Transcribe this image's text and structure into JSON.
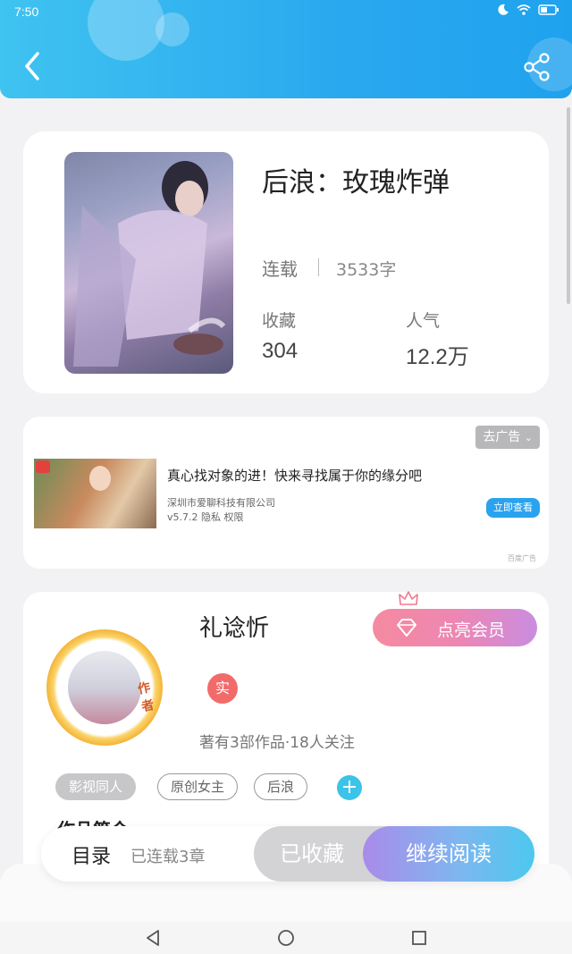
{
  "status": {
    "time": "7:50"
  },
  "book": {
    "title": "后浪：玫瑰炸弹",
    "status": "连载",
    "word_count": "3533字",
    "favorites_label": "收藏",
    "favorites_value": "304",
    "popularity_label": "人气",
    "popularity_value": "12.2万"
  },
  "ad": {
    "remove_label": "去广告",
    "title": "真心找对象的进！快来寻找属于你的缘分吧",
    "company": "深圳市爱聊科技有限公司",
    "meta": "v5.7.2 隐私 权限",
    "cta": "立即查看",
    "source": "百度广告"
  },
  "author": {
    "name": "礼谂忻",
    "avatar_tag": "作者",
    "vip_label": "点亮会员",
    "real_badge": "实",
    "stats": "著有3部作品·18人关注",
    "tags": [
      "影视同人",
      "原创女主",
      "后浪"
    ],
    "add_tag": "+",
    "intro_heading": "作品简介"
  },
  "actions": {
    "toc_label": "目录",
    "toc_count": "已连载3章",
    "saved_label": "已收藏",
    "read_label": "继续阅读"
  },
  "colors": {
    "header_start": "#3fc3f0",
    "header_end": "#1fa2ee",
    "vip_gradient": [
      "#f58aa0",
      "#c98de0"
    ],
    "read_gradient": [
      "#a98bea",
      "#4cc8ef"
    ]
  },
  "icons": {
    "back": "chevron-left-icon",
    "share": "share-icon",
    "moon": "moon-icon",
    "wifi": "wifi-icon",
    "battery": "battery-icon",
    "diamond": "diamond-icon",
    "crown": "crown-icon"
  }
}
